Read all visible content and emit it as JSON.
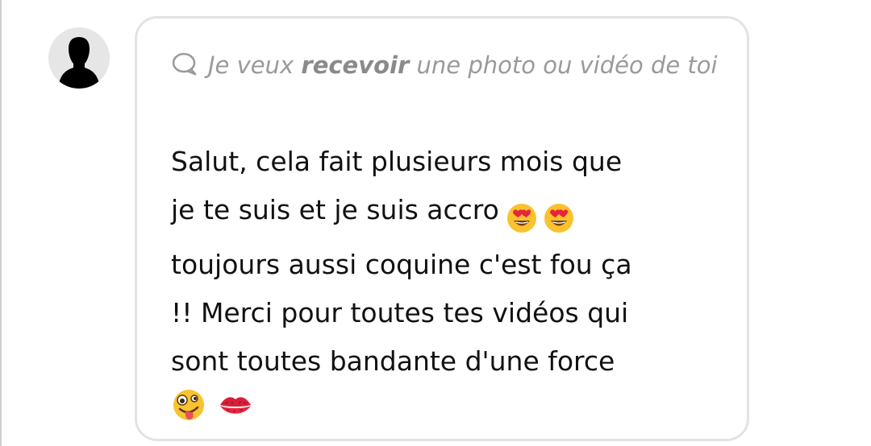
{
  "post": {
    "avatar_icon": "person-silhouette-icon",
    "request": {
      "icon": "speech-bubble-icon",
      "prefix": "Je veux",
      "emphasis": "recevoir",
      "suffix": "une photo ou vidéo de toi"
    },
    "message": {
      "lines": [
        "Salut, cela fait plusieurs mois que",
        "je te suis et je suis accro",
        "toujours aussi coquine c'est fou ça",
        "!! Merci pour toutes tes vidéos qui",
        "sont toutes bandante d'une force"
      ],
      "line2_emojis": [
        "heart-eyes-emoji",
        "heart-eyes-emoji"
      ],
      "final_emojis": [
        "zany-face-emoji",
        "kiss-mark-emoji"
      ]
    }
  },
  "colors": {
    "card_border": "#e3e3e3",
    "request_text": "#9a9a9a",
    "message_text": "#111111",
    "emoji_yellow": "#f9c22e",
    "heart_red": "#e8243c"
  }
}
